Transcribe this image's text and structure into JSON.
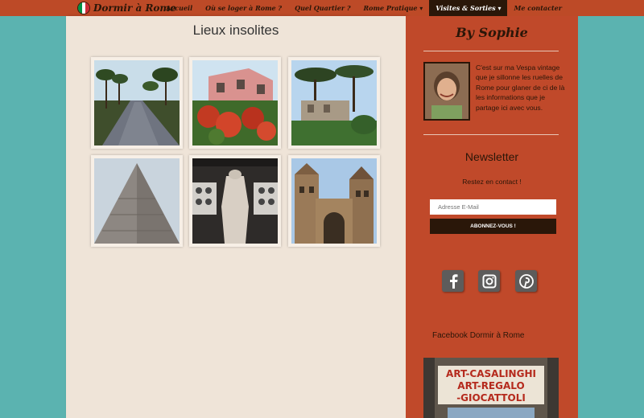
{
  "brand": {
    "name": "Dormir à Rome",
    "flag_colors": [
      "#009246",
      "#ffffff",
      "#ce2b37"
    ]
  },
  "nav": {
    "items": [
      {
        "label": "Accueil",
        "active": false
      },
      {
        "label": "Où se loger à Rome ?",
        "active": false
      },
      {
        "label": "Quel Quartier ?",
        "active": false
      },
      {
        "label": "Rome Pratique ▾",
        "active": false
      },
      {
        "label": "Visites & Sorties ▾",
        "active": true
      },
      {
        "label": "Me contacter",
        "active": false
      }
    ]
  },
  "main": {
    "title": "Lieux insolites"
  },
  "sidebar": {
    "author_title": "By Sophie",
    "bio": "C'est sur ma Vespa vintage que je sillonne les ruelles de Rome pour glaner de ci de là les informations que je partage ici avec vous.",
    "newsletter": {
      "title": "Newsletter",
      "subtitle": "Restez en contact !",
      "email_placeholder": "Adresse E-Mail",
      "button_label": "ABONNEZ-VOUS !"
    },
    "social": [
      "facebook-icon",
      "instagram-icon",
      "pinterest-icon"
    ],
    "facebook_title": "Facebook Dormir à Rome",
    "facebook_sign": [
      "ART-CASALINGHI",
      "ART-REGALO",
      "-GIOCATTOLI"
    ]
  },
  "colors": {
    "navbar": "#bd4a27",
    "sidebar": "#c0492a",
    "content": "#efe4d8",
    "page_bg": "#5bb3b0",
    "dark": "#2a1709"
  }
}
